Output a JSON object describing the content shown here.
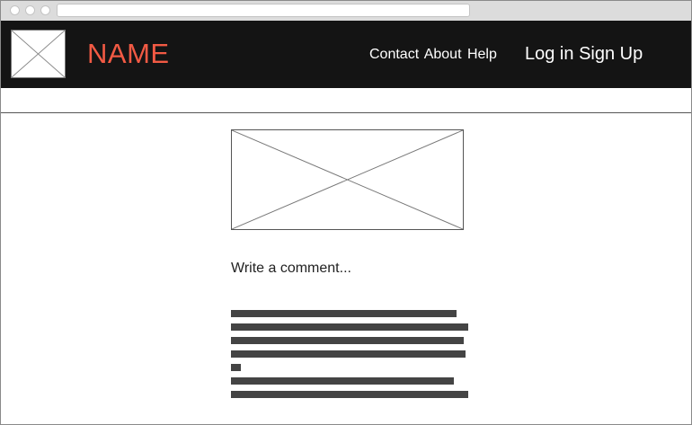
{
  "brand": {
    "name": "NAME",
    "color": "#f25a44"
  },
  "nav": {
    "links": [
      "Contact",
      "About",
      "Help"
    ]
  },
  "auth": {
    "login": "Log in",
    "signup": "Sign Up"
  },
  "main": {
    "comment_prompt": "Write a comment...",
    "image_placeholder": "image-placeholder-icon",
    "text_lines": [
      0.95,
      1.0,
      0.98,
      0.99,
      0.04,
      0.94,
      1.0
    ]
  },
  "colors": {
    "header_bg": "#141414",
    "text_line": "#444444"
  }
}
